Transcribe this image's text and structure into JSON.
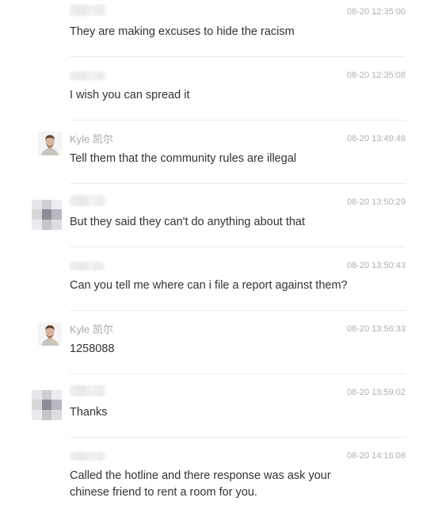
{
  "messages": [
    {
      "sender": "",
      "time": "08-20 12:35:00",
      "text": "They are making excuses to hide the racism",
      "avatar": "none"
    },
    {
      "sender": "",
      "time": "08-20 12:35:08",
      "text": "I wish you can spread it",
      "avatar": "none"
    },
    {
      "sender": "Kyle 凯尔",
      "time": "08-20 13:49:48",
      "text": "Tell them that the community rules are illegal",
      "avatar": "photo"
    },
    {
      "sender": "",
      "time": "08-20 13:50:29",
      "text": "But they said they can't do anything about that",
      "avatar": "blurred"
    },
    {
      "sender": "",
      "time": "08-20 13:50:43",
      "text": "Can you tell me where can i file a report against them?",
      "avatar": "none"
    },
    {
      "sender": "Kyle 凯尔",
      "time": "08-20 13:56:33",
      "text": "1258088",
      "avatar": "photo"
    },
    {
      "sender": "",
      "time": "08-20 13:59:02",
      "text": "Thanks",
      "avatar": "blurred"
    },
    {
      "sender": "",
      "time": "08-20 14:16:08",
      "text": "Called the hotline and there response was ask your chinese friend to rent a room for you.",
      "avatar": "none"
    }
  ]
}
